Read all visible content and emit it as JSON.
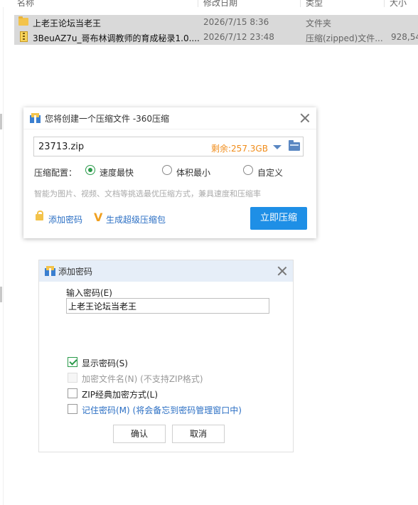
{
  "explorer": {
    "columns": {
      "name": "名称",
      "date": "修改日期",
      "type": "类型",
      "size": "大小"
    },
    "rows": [
      {
        "name": "上老王论坛当老王",
        "date": "2026/7/15 8:36",
        "type": "文件夹",
        "size": "",
        "icon": "folder-icon"
      },
      {
        "name": "3BeuAZ7u_哥布林调教师的育成秘录1.0....",
        "date": "2026/7/12 23:48",
        "type": "压缩(zipped)文件...",
        "size": "928,54",
        "icon": "zip-file-icon"
      }
    ]
  },
  "compress_dialog": {
    "title": "您将创建一个压缩文件 -360压缩",
    "filename": "23713.zip",
    "remaining": "剩余:257.3GB",
    "config_label": "压缩配置：",
    "options": [
      {
        "label": "速度最快",
        "selected": true
      },
      {
        "label": "体积最小",
        "selected": false
      },
      {
        "label": "自定义",
        "selected": false
      }
    ],
    "hint": "智能为图片、视频、文档等挑选最优压缩方式，兼具速度和压缩率",
    "add_password_link": "添加密码",
    "super_pack_link": "生成超级压缩包",
    "compress_button": "立即压缩"
  },
  "password_dialog": {
    "title": "添加密码",
    "input_label": "输入密码(E)",
    "password_value": "上老王论坛当老王",
    "checkboxes": [
      {
        "label": "显示密码(S)",
        "checked": true,
        "disabled": false
      },
      {
        "label": "加密文件名(N) (不支持ZIP格式)",
        "checked": false,
        "disabled": true
      },
      {
        "label": "ZIP经典加密方式(L)",
        "checked": false,
        "disabled": false
      },
      {
        "label": "记住密码(M) (将会备忘到密码管理窗口中)",
        "checked": false,
        "disabled": false
      }
    ],
    "ok_button": "确认",
    "cancel_button": "取消"
  },
  "colors": {
    "accent": "#1e8fe6",
    "remaining_text": "#f08c1a",
    "link": "#2b6fc4",
    "selected_row": "#d9d9d9",
    "radio_checked": "#2a9a4a"
  }
}
